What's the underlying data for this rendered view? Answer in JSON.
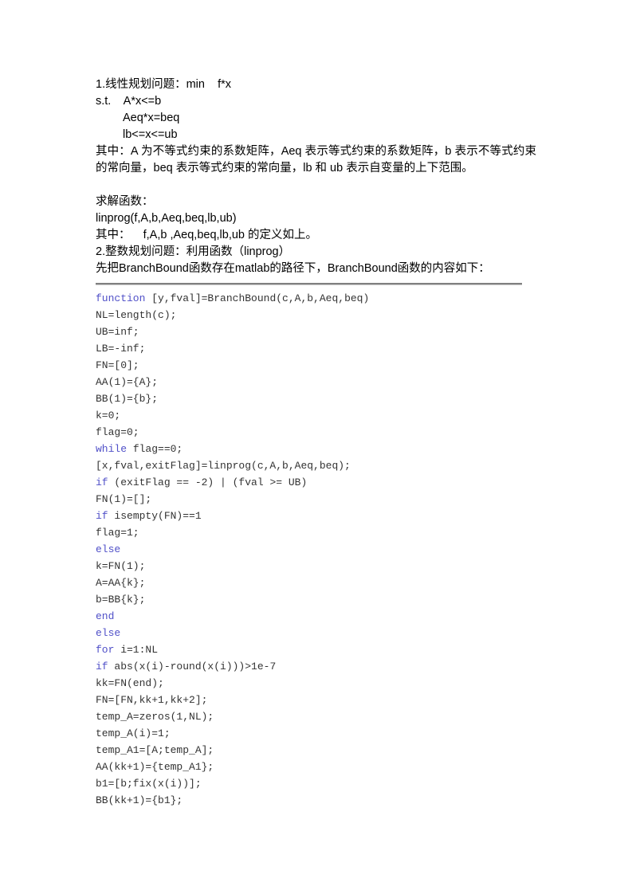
{
  "document": {
    "title": "MATLAB 线性规划与整数规划",
    "keyword_color": "#5050c8",
    "code_color": "#333333",
    "divider_color": "#808080"
  },
  "prose": {
    "lines": [
      {
        "id": "l1",
        "text": "1.线性规划问题：min    f*x",
        "indent": 0
      },
      {
        "id": "l2",
        "text": "s.t.    A*x<=b",
        "indent": 0
      },
      {
        "id": "l3",
        "text": "Aeq*x=beq",
        "indent": 1
      },
      {
        "id": "l4",
        "text": "lb<=x<=ub",
        "indent": 1
      },
      {
        "id": "l5",
        "text": "其中：A 为不等式约束的系数矩阵，Aeq 表示等式约束的系数矩阵，b 表示不等式约束的常向量，beq 表示等式约束的常向量，lb 和 ub 表示自变量的上下范围。",
        "indent": 0,
        "wrap": true
      },
      {
        "id": "l6",
        "text": "",
        "indent": 0
      },
      {
        "id": "l7",
        "text": "求解函数：",
        "indent": 0
      },
      {
        "id": "l8",
        "text": "linprog(f,A,b,Aeq,beq,lb,ub)",
        "indent": 0
      },
      {
        "id": "l9",
        "text": "其中：    f,A,b ,Aeq,beq,lb,ub 的定义如上。",
        "indent": 0
      },
      {
        "id": "l10",
        "text": "2.整数规划问题：利用函数（linprog）",
        "indent": 0
      },
      {
        "id": "l11",
        "text": "先把BranchBound函数存在matlab的路径下，BranchBound函数的内容如下：",
        "indent": 0
      }
    ]
  },
  "code": {
    "lines": [
      {
        "id": "c1",
        "keyword": "function",
        "rest": " [y,fval]=BranchBound(c,A,b,Aeq,beq)"
      },
      {
        "id": "c2",
        "keyword": "",
        "rest": "NL=length(c);"
      },
      {
        "id": "c3",
        "keyword": "",
        "rest": "UB=inf;"
      },
      {
        "id": "c4",
        "keyword": "",
        "rest": "LB=-inf;"
      },
      {
        "id": "c5",
        "keyword": "",
        "rest": "FN=[0];"
      },
      {
        "id": "c6",
        "keyword": "",
        "rest": "AA(1)={A};"
      },
      {
        "id": "c7",
        "keyword": "",
        "rest": "BB(1)={b};"
      },
      {
        "id": "c8",
        "keyword": "",
        "rest": "k=0;"
      },
      {
        "id": "c9",
        "keyword": "",
        "rest": "flag=0;"
      },
      {
        "id": "c10",
        "keyword": "while",
        "rest": " flag==0;"
      },
      {
        "id": "c11",
        "keyword": "",
        "rest": "[x,fval,exitFlag]=linprog(c,A,b,Aeq,beq);"
      },
      {
        "id": "c12",
        "keyword": "if",
        "rest": " (exitFlag == -2) | (fval >= UB)"
      },
      {
        "id": "c13",
        "keyword": "",
        "rest": "FN(1)=[];"
      },
      {
        "id": "c14",
        "keyword": "if",
        "rest": " isempty(FN)==1"
      },
      {
        "id": "c15",
        "keyword": "",
        "rest": "flag=1;"
      },
      {
        "id": "c16",
        "keyword": "else",
        "rest": ""
      },
      {
        "id": "c17",
        "keyword": "",
        "rest": "k=FN(1);"
      },
      {
        "id": "c18",
        "keyword": "",
        "rest": "A=AA{k};"
      },
      {
        "id": "c19",
        "keyword": "",
        "rest": "b=BB{k};"
      },
      {
        "id": "c20",
        "keyword": "end",
        "rest": ""
      },
      {
        "id": "c21",
        "keyword": "else",
        "rest": ""
      },
      {
        "id": "c22",
        "keyword": "for",
        "rest": " i=1:NL"
      },
      {
        "id": "c23",
        "keyword": "if",
        "rest": " abs(x(i)-round(x(i)))>1e-7"
      },
      {
        "id": "c24",
        "keyword": "",
        "rest": "kk=FN(end);"
      },
      {
        "id": "c25",
        "keyword": "",
        "rest": "FN=[FN,kk+1,kk+2];"
      },
      {
        "id": "c26",
        "keyword": "",
        "rest": "temp_A=zeros(1,NL);"
      },
      {
        "id": "c27",
        "keyword": "",
        "rest": "temp_A(i)=1;"
      },
      {
        "id": "c28",
        "keyword": "",
        "rest": "temp_A1=[A;temp_A];"
      },
      {
        "id": "c29",
        "keyword": "",
        "rest": "AA(kk+1)={temp_A1};"
      },
      {
        "id": "c30",
        "keyword": "",
        "rest": "b1=[b;fix(x(i))];"
      },
      {
        "id": "c31",
        "keyword": "",
        "rest": "BB(kk+1)={b1};"
      }
    ]
  }
}
